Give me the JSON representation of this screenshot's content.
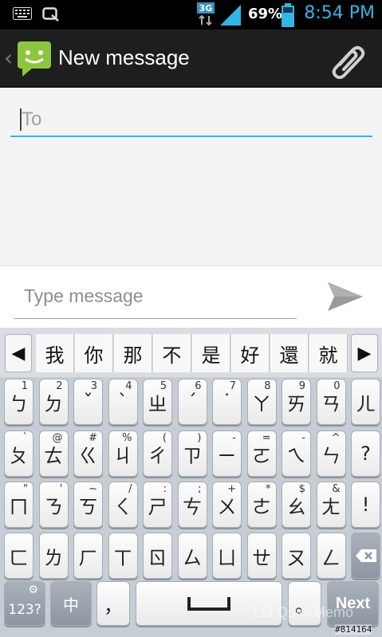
{
  "status_bar": {
    "network": "3G",
    "battery_percent": "69%",
    "time": "8:54 PM",
    "left_icons": [
      "keyboard-icon",
      "quickmemo-icon"
    ]
  },
  "action_bar": {
    "title": "New message",
    "back": "‹"
  },
  "compose": {
    "to_placeholder": "To",
    "message_placeholder": "Type message"
  },
  "keyboard": {
    "candidates": [
      "我",
      "你",
      "那",
      "不",
      "是",
      "好",
      "還",
      "就"
    ],
    "prev": "◀",
    "next_arrow": "▶",
    "row1": [
      {
        "k": "ㄅ",
        "s": "1"
      },
      {
        "k": "ㄉ",
        "s": "2"
      },
      {
        "k": "ˇ",
        "s": "3"
      },
      {
        "k": "ˋ",
        "s": "4"
      },
      {
        "k": "ㄓ",
        "s": "5"
      },
      {
        "k": "ˊ",
        "s": "6"
      },
      {
        "k": "˙",
        "s": "7"
      },
      {
        "k": "ㄚ",
        "s": "8"
      },
      {
        "k": "ㄞ",
        "s": "9"
      },
      {
        "k": "ㄢ",
        "s": "0"
      },
      {
        "k": "ㄦ",
        "s": ""
      }
    ],
    "row2": [
      {
        "k": "ㄆ",
        "s": "`"
      },
      {
        "k": "ㄊ",
        "s": "@"
      },
      {
        "k": "ㄍ",
        "s": "#"
      },
      {
        "k": "ㄐ",
        "s": "%"
      },
      {
        "k": "ㄔ",
        "s": "("
      },
      {
        "k": "ㄗ",
        "s": ")"
      },
      {
        "k": "ㄧ",
        "s": "-"
      },
      {
        "k": "ㄛ",
        "s": "="
      },
      {
        "k": "ㄟ",
        "s": "-"
      },
      {
        "k": "ㄣ",
        "s": "^"
      },
      {
        "k": "?",
        "s": ""
      }
    ],
    "row3": [
      {
        "k": "ㄇ",
        "s": "\""
      },
      {
        "k": "ㄋ",
        "s": "'"
      },
      {
        "k": "ㄎ",
        "s": "~"
      },
      {
        "k": "ㄑ",
        "s": "/"
      },
      {
        "k": "ㄕ",
        "s": ":"
      },
      {
        "k": "ㄘ",
        "s": ";"
      },
      {
        "k": "ㄨ",
        "s": "+"
      },
      {
        "k": "ㄜ",
        "s": "*"
      },
      {
        "k": "ㄠ",
        "s": "$"
      },
      {
        "k": "ㄤ",
        "s": "&"
      },
      {
        "k": "!",
        "s": ""
      }
    ],
    "row4": [
      {
        "k": "ㄈ",
        "s": ""
      },
      {
        "k": "ㄌ",
        "s": ""
      },
      {
        "k": "ㄏ",
        "s": ""
      },
      {
        "k": "ㄒ",
        "s": ""
      },
      {
        "k": "ㄖ",
        "s": ""
      },
      {
        "k": "ㄙ",
        "s": ""
      },
      {
        "k": "ㄩ",
        "s": ""
      },
      {
        "k": "ㄝ",
        "s": ""
      },
      {
        "k": "ㄡ",
        "s": ""
      },
      {
        "k": "ㄥ",
        "s": ""
      }
    ],
    "mode_label": "123?",
    "lang_label": "中",
    "comma": "，",
    "space_symbol": "␣",
    "period": "。",
    "next_label": "Next"
  },
  "watermark": {
    "text": "LG QuickMemo",
    "id": "#814164"
  }
}
